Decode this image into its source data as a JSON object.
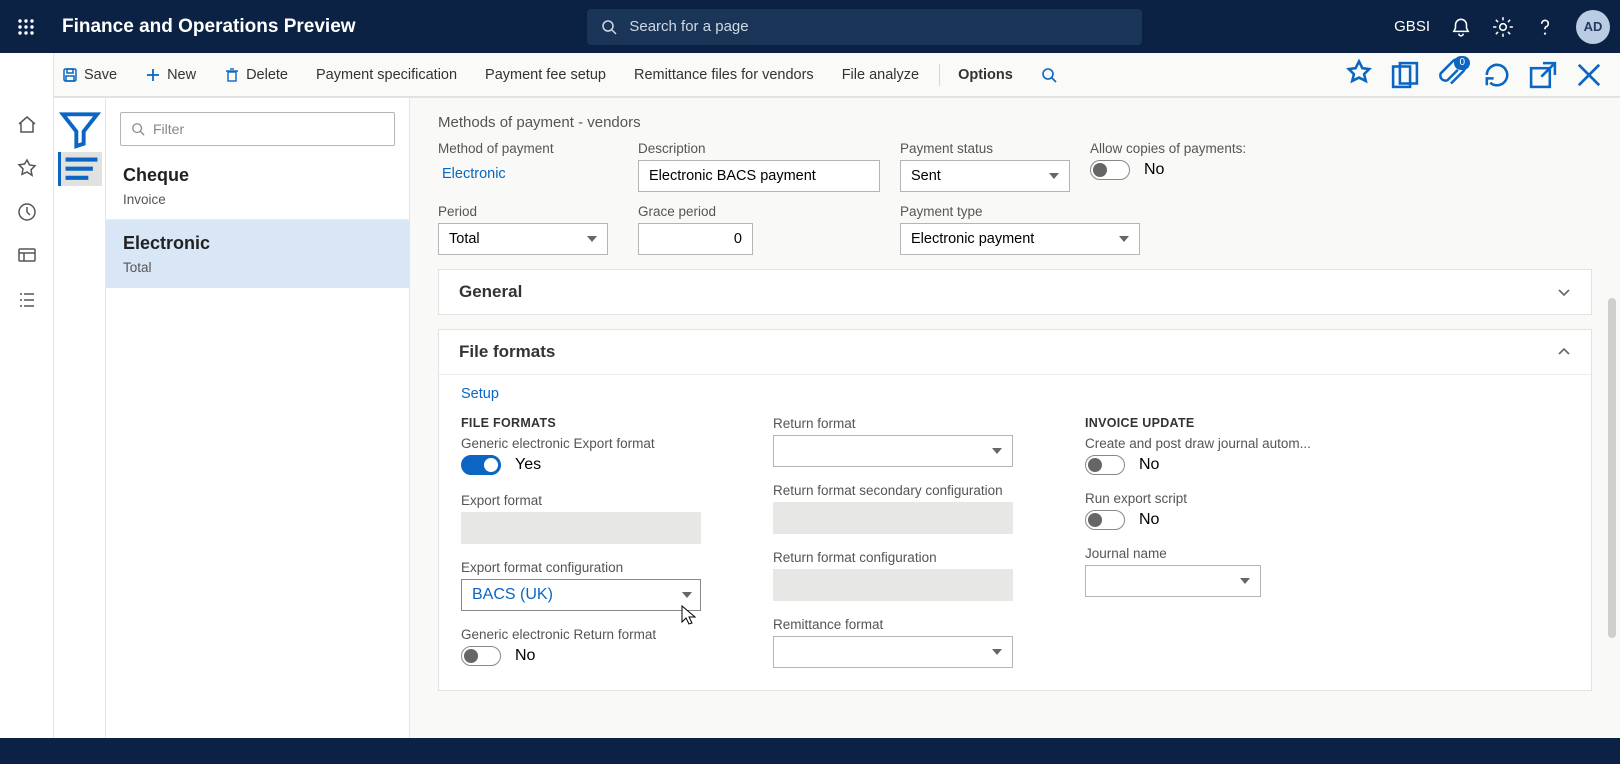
{
  "header": {
    "app_title": "Finance and Operations Preview",
    "search_placeholder": "Search for a page",
    "company": "GBSI",
    "avatar": "AD"
  },
  "actions": {
    "save": "Save",
    "new": "New",
    "delete": "Delete",
    "payment_spec": "Payment specification",
    "payment_fee": "Payment fee setup",
    "remittance": "Remittance files for vendors",
    "file_analyze": "File analyze",
    "options": "Options",
    "attach_badge": "0"
  },
  "filter": {
    "placeholder": "Filter"
  },
  "list": [
    {
      "title": "Cheque",
      "sub": "Invoice"
    },
    {
      "title": "Electronic",
      "sub": "Total"
    }
  ],
  "page": {
    "heading": "Methods of payment - vendors",
    "labels": {
      "method": "Method of payment",
      "description": "Description",
      "status": "Payment status",
      "allow_copies": "Allow copies of payments:",
      "period": "Period",
      "grace": "Grace period",
      "ptype": "Payment type"
    },
    "values": {
      "method": "Electronic",
      "description": "Electronic BACS payment",
      "status": "Sent",
      "allow_copies": "No",
      "period": "Total",
      "grace": "0",
      "ptype": "Electronic payment"
    }
  },
  "panels": {
    "general": "General",
    "file_formats": "File formats",
    "setup_link": "Setup"
  },
  "ff": {
    "col1_title": "FILE FORMATS",
    "generic_export_lbl": "Generic electronic Export format",
    "generic_export_val": "Yes",
    "export_format_lbl": "Export format",
    "export_conf_lbl": "Export format configuration",
    "export_conf_val": "BACS (UK)",
    "generic_return_lbl": "Generic electronic Return format",
    "generic_return_val": "No",
    "return_format_lbl": "Return format",
    "return_sec_lbl": "Return format secondary configuration",
    "return_conf_lbl": "Return format configuration",
    "remit_lbl": "Remittance format",
    "col3_title": "INVOICE UPDATE",
    "create_post_lbl": "Create and post draw journal autom...",
    "create_post_val": "No",
    "run_export_lbl": "Run export script",
    "run_export_val": "No",
    "journal_lbl": "Journal name"
  }
}
